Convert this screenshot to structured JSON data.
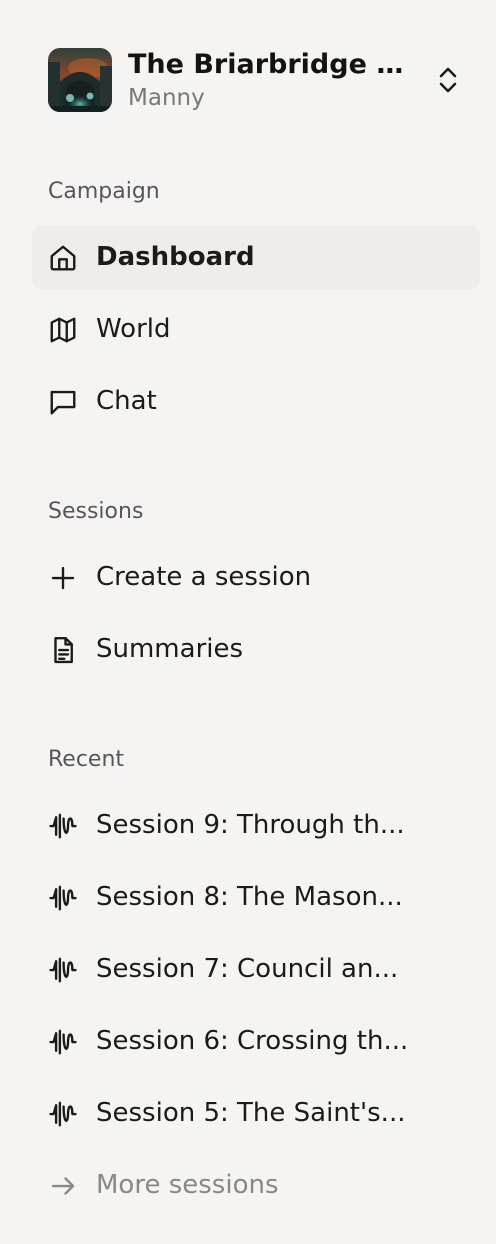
{
  "campaign": {
    "title": "The Briarbridge Co...",
    "owner": "Manny"
  },
  "sections": {
    "campaign_label": "Campaign",
    "sessions_label": "Sessions",
    "recent_label": "Recent"
  },
  "campaign_nav": [
    {
      "label": "Dashboard",
      "icon": "home-icon",
      "active": true
    },
    {
      "label": "World",
      "icon": "map-icon"
    },
    {
      "label": "Chat",
      "icon": "chat-bubble-icon"
    }
  ],
  "sessions_nav": [
    {
      "label": "Create a session",
      "icon": "plus-icon"
    },
    {
      "label": "Summaries",
      "icon": "document-icon"
    }
  ],
  "recent_sessions": [
    {
      "label": "Session 9: Through th...",
      "icon": "audio-waveform-icon"
    },
    {
      "label": "Session 8: The Mason...",
      "icon": "audio-waveform-icon"
    },
    {
      "label": "Session 7: Council an...",
      "icon": "audio-waveform-icon"
    },
    {
      "label": "Session 6: Crossing th...",
      "icon": "audio-waveform-icon"
    },
    {
      "label": "Session 5: The Saint's...",
      "icon": "audio-waveform-icon"
    }
  ],
  "more_sessions": {
    "label": "More sessions",
    "icon": "arrow-right-icon"
  },
  "colors": {
    "background": "#f5f4f2",
    "active_background": "#eeedea",
    "text": "#1c1b1a",
    "muted_text": "#8a8886",
    "section_label": "#58565a"
  }
}
